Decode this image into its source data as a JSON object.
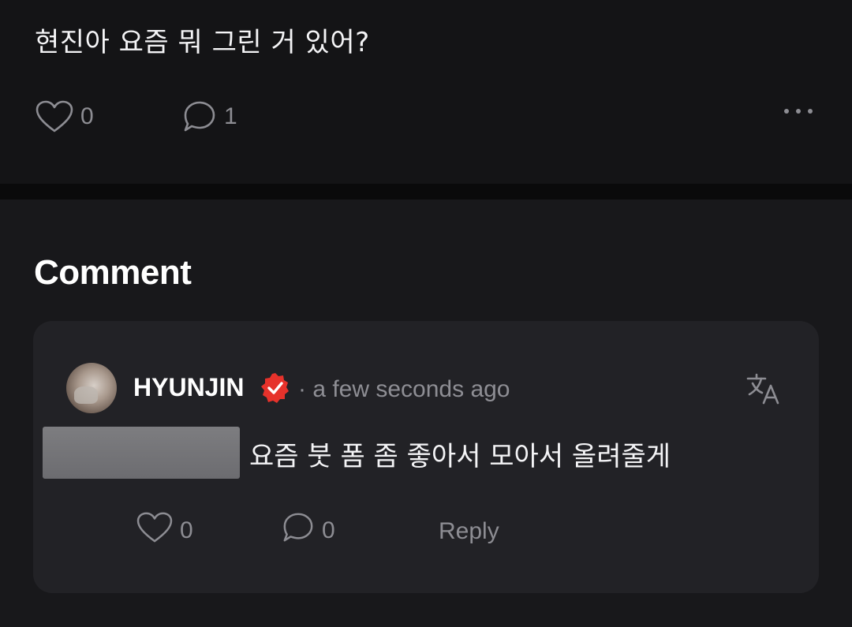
{
  "post": {
    "text": "현진아 요즘 뭐 그린 거 있어?",
    "like_count": "0",
    "comment_count": "1",
    "icons": [
      "heart-icon",
      "comment-bubble-icon",
      "more-dots-icon"
    ]
  },
  "comments_section": {
    "title": "Comment",
    "comments": [
      {
        "username": "HYUNJIN",
        "verified": true,
        "timestamp": "· a few seconds ago",
        "text": "요즘 붓 폼 좀 좋아서 모아서 올려줄게",
        "like_count": "0",
        "reply_count": "0",
        "reply_label": "Reply"
      }
    ]
  },
  "colors": {
    "background": "#111113",
    "card": "#222226",
    "muted_text": "#8d8d93",
    "verified_badge": "#e6322b"
  }
}
